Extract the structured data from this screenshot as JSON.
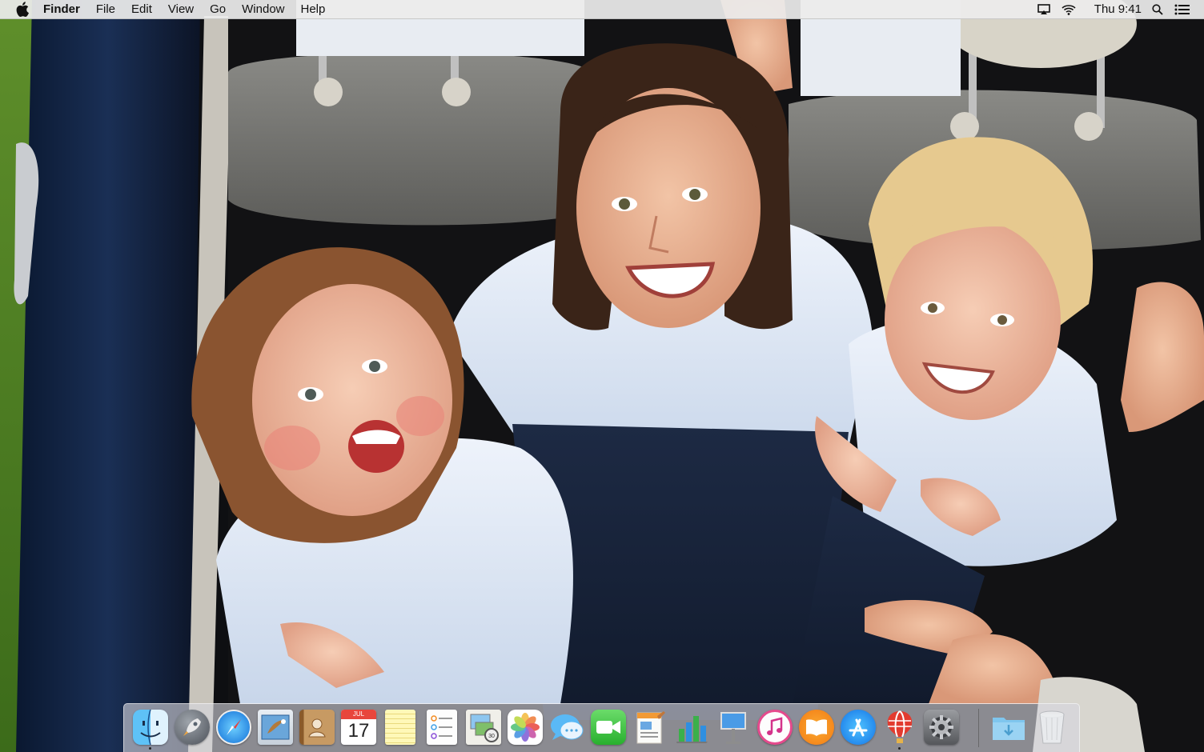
{
  "menubar": {
    "apple_icon": "apple-logo-icon",
    "app_name": "Finder",
    "menus": [
      "File",
      "Edit",
      "View",
      "Go",
      "Window",
      "Help"
    ],
    "status_icons": [
      "airplay-icon",
      "wifi-icon",
      "spotlight-search-icon",
      "notification-center-icon"
    ],
    "clock": "Thu 9:41"
  },
  "dock": {
    "apps": [
      {
        "name": "Finder",
        "icon": "finder-icon",
        "running": true
      },
      {
        "name": "Launchpad",
        "icon": "launchpad-icon",
        "running": false
      },
      {
        "name": "Safari",
        "icon": "safari-icon",
        "running": false
      },
      {
        "name": "Mail",
        "icon": "mail-icon",
        "running": false
      },
      {
        "name": "Contacts",
        "icon": "contacts-icon",
        "running": false
      },
      {
        "name": "Calendar",
        "icon": "calendar-icon",
        "running": false,
        "month": "JUL",
        "day": "17"
      },
      {
        "name": "Notes",
        "icon": "notes-icon",
        "running": false
      },
      {
        "name": "Reminders",
        "icon": "reminders-icon",
        "running": false
      },
      {
        "name": "Preview",
        "icon": "preview-icon",
        "running": false
      },
      {
        "name": "Photos",
        "icon": "photos-icon",
        "running": false
      },
      {
        "name": "Messages",
        "icon": "messages-icon",
        "running": false
      },
      {
        "name": "FaceTime",
        "icon": "facetime-icon",
        "running": false
      },
      {
        "name": "Pages",
        "icon": "pages-icon",
        "running": false
      },
      {
        "name": "Numbers",
        "icon": "numbers-icon",
        "running": false
      },
      {
        "name": "Keynote",
        "icon": "keynote-icon",
        "running": false
      },
      {
        "name": "iTunes",
        "icon": "itunes-icon",
        "running": false
      },
      {
        "name": "iBooks",
        "icon": "ibooks-icon",
        "running": false
      },
      {
        "name": "App Store",
        "icon": "app-store-icon",
        "running": false
      },
      {
        "name": "Hot Air Balloon App",
        "icon": "hot-air-balloon-icon",
        "running": true
      },
      {
        "name": "System Preferences",
        "icon": "system-preferences-icon",
        "running": false
      }
    ],
    "stacks": [
      {
        "name": "Downloads",
        "icon": "downloads-folder-icon"
      },
      {
        "name": "Trash",
        "icon": "trash-icon"
      }
    ]
  }
}
